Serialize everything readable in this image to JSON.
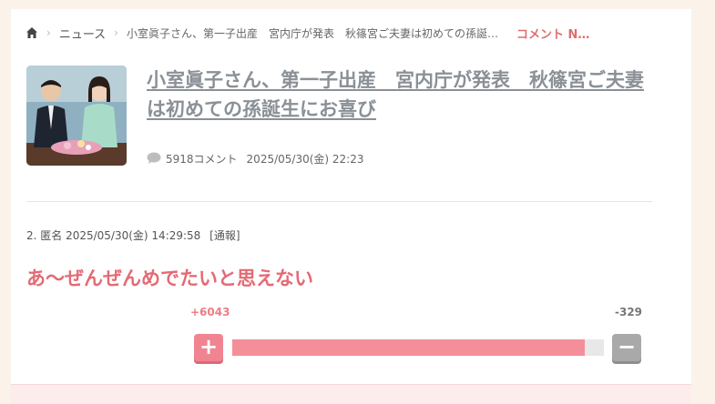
{
  "breadcrumb": {
    "home_icon": "home-icon",
    "news": "ニュース",
    "current": "小室眞子さん、第一子出産　宮内庁が発表　秋篠宮ご夫妻は初めての孫誕…",
    "comment": "コメント N…"
  },
  "article": {
    "title": "小室眞子さん、第一子出産　宮内庁が発表　秋篠宮ご夫妻は初めての孫誕生にお喜び",
    "comment_icon": "speech-bubble-icon",
    "comment_count": "5918コメント",
    "date": "2025/05/30(金) 22:23"
  },
  "comment": {
    "header": "2. 匿名 2025/05/30(金) 14:29:58",
    "report": "[通報]",
    "body": "あ～ぜんぜんめでたいと思えない",
    "plus_count": "+6043",
    "minus_count": "-329",
    "plus_label": "+",
    "minus_label": "−",
    "plus_ratio": 0.948
  },
  "colors": {
    "accent": "#e46a74",
    "plus": "#f08591",
    "minus": "#a9a9a9",
    "background": "#fbf3ea"
  }
}
